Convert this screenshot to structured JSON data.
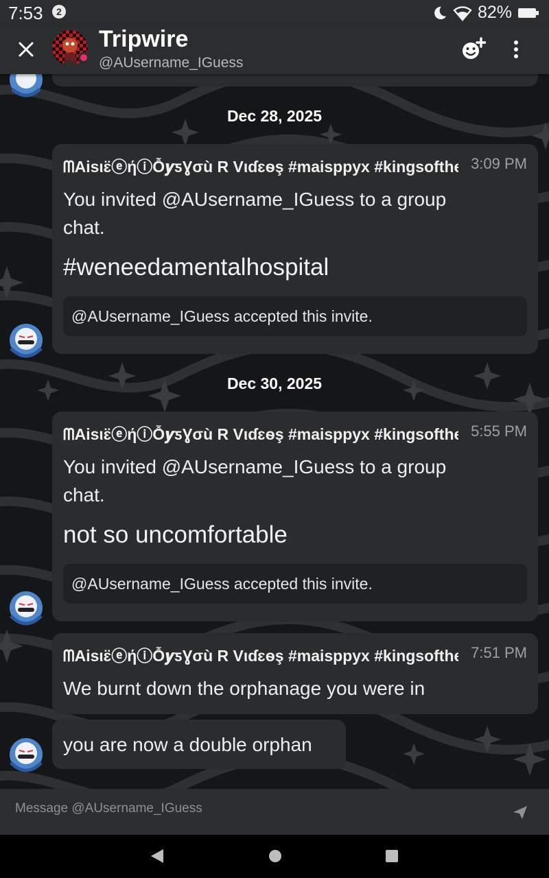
{
  "status_bar": {
    "time": "7:53",
    "notification_count": "2",
    "battery": "82%",
    "icons": [
      "moon-icon",
      "wifi-icon",
      "battery-icon"
    ]
  },
  "header": {
    "name": "Tripwire",
    "handle": "@AUsername_IGuess",
    "icons": [
      "close-icon",
      "add-friend-icon",
      "more-vert-icon"
    ],
    "online_color": "#ed2f66"
  },
  "messages": [
    {
      "date": "Dec 28, 2025",
      "author": "ᗰAisιɛ̈ⓔήⓘỖ𝒚ƽƔσù R Vιɗɛѳş #maisppyx #kingsofthepark",
      "time": "3:09 PM",
      "text": "You invited @AUsername_IGuess to a group chat.",
      "big_text": "#weneedamentalhospital",
      "invite_status": "@AUsername_IGuess accepted this invite."
    },
    {
      "date": "Dec 30, 2025",
      "author": "ᗰAisιɛ̈ⓔήⓘỖ𝒚ƽƔσù R Vιɗɛѳş #maisppyx #kingsofthepark",
      "time": "5:55 PM",
      "text": "You invited @AUsername_IGuess to a group chat.",
      "big_text": "not so uncomfortable",
      "invite_status": "@AUsername_IGuess accepted this invite."
    },
    {
      "author": "ᗰAisιɛ̈ⓔήⓘỖ𝒚ƽƔσù R Vιɗɛѳş #maisppyx #kingsofthepark",
      "time": "7:51 PM",
      "text": "We burnt down the orphanage you were in"
    },
    {
      "text": "you are now a double orphan"
    }
  ],
  "composer": {
    "placeholder": "Message @AUsername_IGuess",
    "send_icon": "send-icon"
  },
  "nav": {
    "icons": [
      "back-icon",
      "home-icon",
      "recents-icon"
    ]
  },
  "colors": {
    "background": "#151617",
    "bubble": "#2a2c2e",
    "bar": "#2b2d2f"
  }
}
